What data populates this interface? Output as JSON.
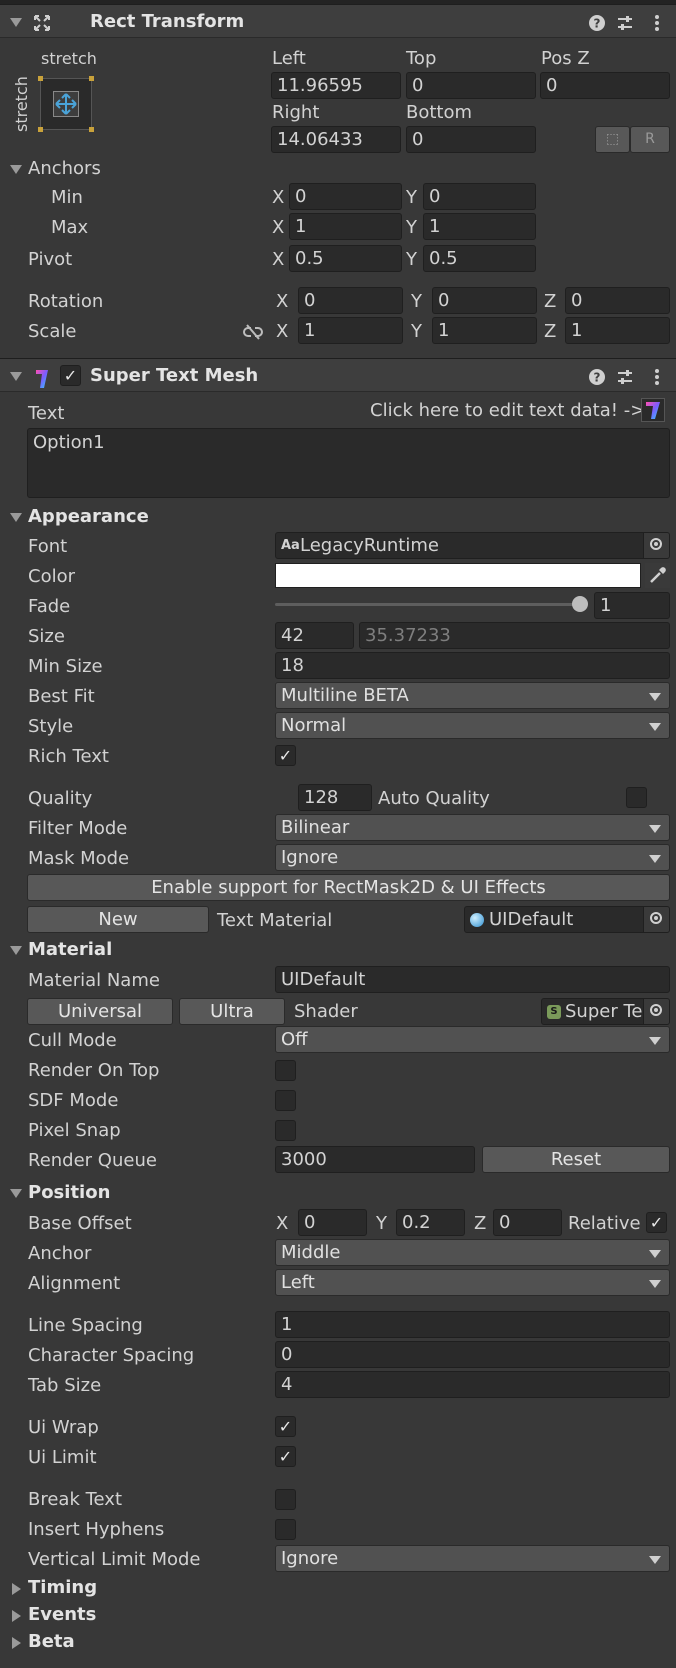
{
  "rect_transform": {
    "title": "Rect Transform",
    "stretch_top": "stretch",
    "stretch_side": "stretch",
    "left_label": "Left",
    "left_value": "11.96595",
    "top_label": "Top",
    "top_value": "0",
    "posz_label": "Pos Z",
    "posz_value": "0",
    "right_label": "Right",
    "right_value": "14.06433",
    "bottom_label": "Bottom",
    "bottom_value": "0",
    "blueprint_btn": "⬚",
    "raw_btn": "R",
    "anchors_label": "Anchors",
    "min_label": "Min",
    "min_x": "0",
    "min_y": "0",
    "max_label": "Max",
    "max_x": "1",
    "max_y": "1",
    "pivot_label": "Pivot",
    "pivot_x": "0.5",
    "pivot_y": "0.5",
    "rotation_label": "Rotation",
    "rot_x": "0",
    "rot_y": "0",
    "rot_z": "0",
    "scale_label": "Scale",
    "scale_x": "1",
    "scale_y": "1",
    "scale_z": "1",
    "x": "X",
    "y": "Y",
    "z": "Z"
  },
  "super_text_mesh": {
    "title": "Super Text Mesh",
    "enabled_check": "✓",
    "text_label": "Text",
    "edit_link": "Click here to edit text data! ->",
    "text_value": "Option1",
    "appearance": {
      "header": "Appearance",
      "font_label": "Font",
      "font_prefix": "Aa",
      "font_value": "LegacyRuntime",
      "color_label": "Color",
      "color_value": "#ffffff",
      "fade_label": "Fade",
      "fade_value": "1",
      "fade_level": 1.0,
      "size_label": "Size",
      "size_value": "42",
      "size_actual": "35.37233",
      "min_size_label": "Min Size",
      "min_size_value": "18",
      "best_fit_label": "Best Fit",
      "best_fit_value": "Multiline BETA",
      "style_label": "Style",
      "style_value": "Normal",
      "rich_text_label": "Rich Text",
      "rich_text_check": "✓",
      "quality_label": "Quality",
      "quality_value": "128",
      "auto_quality_label": "Auto Quality",
      "filter_mode_label": "Filter Mode",
      "filter_mode_value": "Bilinear",
      "mask_mode_label": "Mask Mode",
      "mask_mode_value": "Ignore",
      "enable_support_btn": "Enable support for RectMask2D & UI Effects",
      "new_btn": "New",
      "text_material_label": "Text Material",
      "text_material_value": "UIDefault"
    },
    "material": {
      "header": "Material",
      "name_label": "Material Name",
      "name_value": "UIDefault",
      "universal_btn": "Universal",
      "ultra_btn": "Ultra",
      "shader_label": "Shader",
      "shader_value": "Super Te",
      "cull_mode_label": "Cull Mode",
      "cull_mode_value": "Off",
      "render_on_top_label": "Render On Top",
      "sdf_mode_label": "SDF Mode",
      "pixel_snap_label": "Pixel Snap",
      "render_queue_label": "Render Queue",
      "render_queue_value": "3000",
      "reset_btn": "Reset"
    },
    "position": {
      "header": "Position",
      "base_offset_label": "Base Offset",
      "offset_x": "0",
      "offset_y": "0.2",
      "offset_z": "0",
      "relative_label": "Relative",
      "relative_check": "✓",
      "anchor_label": "Anchor",
      "anchor_value": "Middle",
      "alignment_label": "Alignment",
      "alignment_value": "Left",
      "line_spacing_label": "Line Spacing",
      "line_spacing_value": "1",
      "char_spacing_label": "Character Spacing",
      "char_spacing_value": "0",
      "tab_size_label": "Tab Size",
      "tab_size_value": "4",
      "ui_wrap_label": "Ui Wrap",
      "ui_wrap_check": "✓",
      "ui_limit_label": "Ui Limit",
      "ui_limit_check": "✓",
      "break_text_label": "Break Text",
      "insert_hyphens_label": "Insert Hyphens",
      "vertical_limit_label": "Vertical Limit Mode",
      "vertical_limit_value": "Ignore"
    },
    "timing_header": "Timing",
    "events_header": "Events",
    "beta_header": "Beta"
  },
  "icons": {
    "help": "help-icon",
    "presets": "presets-icon",
    "menu": "kebab-menu-icon",
    "move": "move-tool-icon",
    "link": "unlink-icon",
    "eyedropper": "eyedropper-icon"
  }
}
